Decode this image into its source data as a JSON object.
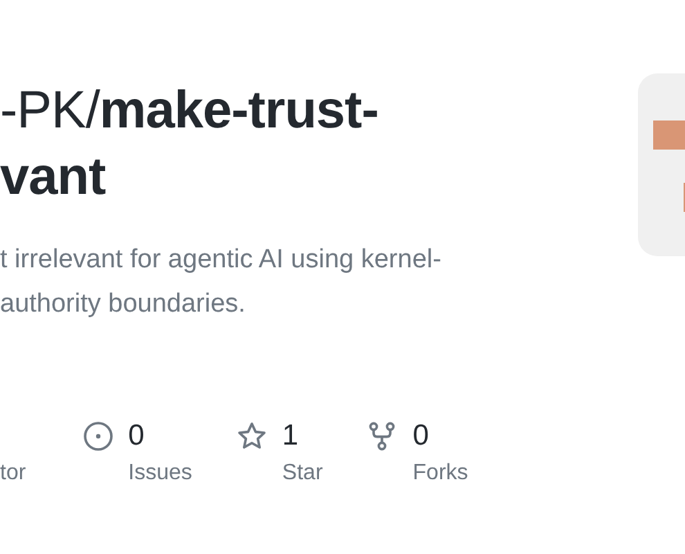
{
  "title_lines": [
    "-PK/**make-trust-**",
    "**vant**"
  ],
  "description_lines": [
    "t irrelevant for agentic AI using kernel-",
    "authority boundaries."
  ],
  "stats": [
    {
      "kind": "label_only",
      "label": "tor"
    },
    {
      "kind": "issues",
      "count": "0",
      "label": "Issues"
    },
    {
      "kind": "star",
      "count": "1",
      "label": "Star"
    },
    {
      "kind": "fork",
      "count": "0",
      "label": "Forks"
    }
  ],
  "avatar": {
    "kind": "identicon"
  }
}
